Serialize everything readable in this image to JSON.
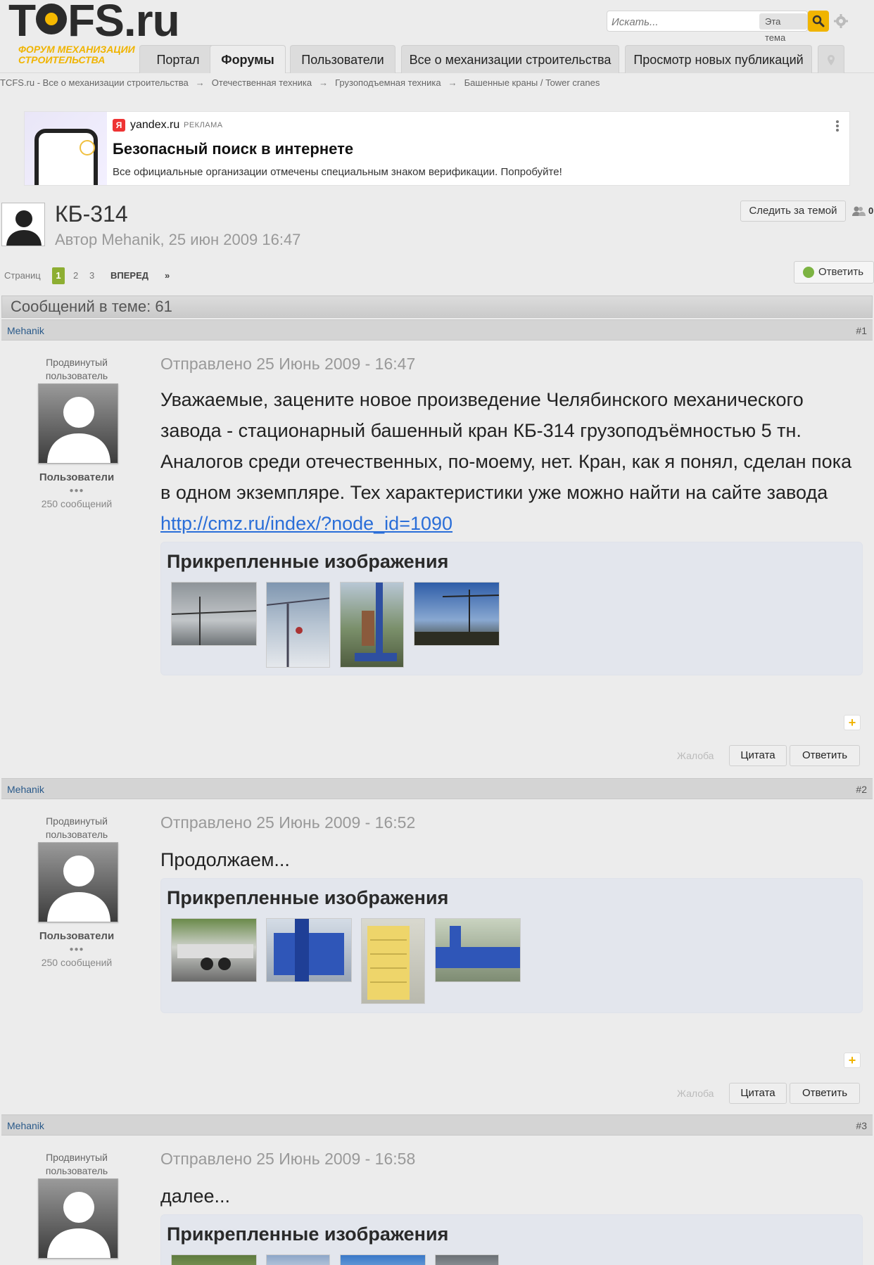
{
  "logo": {
    "brand": "TCFS.ru",
    "prefix": "T",
    "suffix": "FS.ru",
    "tagline": "ФОРУМ МЕХАНИЗАЦИИ\nСТРОИТЕЛЬСТВА"
  },
  "search": {
    "placeholder": "Искать...",
    "scope": "Эта тема",
    "icon": "search-icon",
    "accent": "#f0b400"
  },
  "nav": {
    "tabs": [
      {
        "label": "Портал"
      },
      {
        "label": "Форумы"
      },
      {
        "label": "Пользователи"
      },
      {
        "label": "Все о механизации строительства"
      },
      {
        "label": "Просмотр новых публикаций"
      }
    ]
  },
  "breadcrumb": [
    "TCFS.ru - Все о механизации строительства",
    "Отечественная техника",
    "Грузоподъемная техника",
    "Башенные краны / Tower cranes"
  ],
  "breadcrumb_sep": "→",
  "ad": {
    "logo_letter": "Я",
    "domain": "yandex.ru",
    "label": "РЕКЛАМА",
    "title": "Безопасный поиск в интернете",
    "text": "Все официальные организации отмечены специальным знаком верификации. Попробуйте!"
  },
  "topic": {
    "title": "КБ-314",
    "meta": "Автор Mehanik, 25 июн 2009 16:47",
    "follow_label": "Следить за темой",
    "followers": "0",
    "reply_label": "Ответить",
    "messages_bar": "Сообщений в теме: 61"
  },
  "pagination": {
    "label": "Страниц",
    "pages": [
      "1",
      "2",
      "3"
    ],
    "next": "ВПЕРЕД",
    "last": "»"
  },
  "posts": [
    {
      "author": "Mehanik",
      "num": "#1",
      "rank": "Продвинутый\nпользователь",
      "group": "Пользователи",
      "pips": "●●●",
      "count": "250 сообщений",
      "date": "Отправлено 25 Июнь 2009 - 16:47",
      "body": "Уважаемые, зацените новое произведение Челябинского механического завода - стационарный башенный кран КБ-314 грузоподъёмностью 5 тн. Аналогов среди отечественных, по-моему, нет. Кран, как я понял, сделан пока в одном экземпляре. Тех характеристики уже можно найти на сайте завода ",
      "link": "http://cmz.ru/index/?node_id=1090",
      "attach_title": "Прикрепленные изображения",
      "report": "Жалоба",
      "quote": "Цитата",
      "reply": "Ответить"
    },
    {
      "author": "Mehanik",
      "num": "#2",
      "rank": "Продвинутый\nпользователь",
      "group": "Пользователи",
      "pips": "●●●",
      "count": "250 сообщений",
      "date": "Отправлено 25 Июнь 2009 - 16:52",
      "body": "Продолжаем...",
      "attach_title": "Прикрепленные изображения",
      "report": "Жалоба",
      "quote": "Цитата",
      "reply": "Ответить"
    },
    {
      "author": "Mehanik",
      "num": "#3",
      "rank": "Продвинутый\nпользователь",
      "date": "Отправлено 25 Июнь 2009 - 16:58",
      "body": "далее...",
      "attach_title": "Прикрепленные изображения"
    }
  ]
}
